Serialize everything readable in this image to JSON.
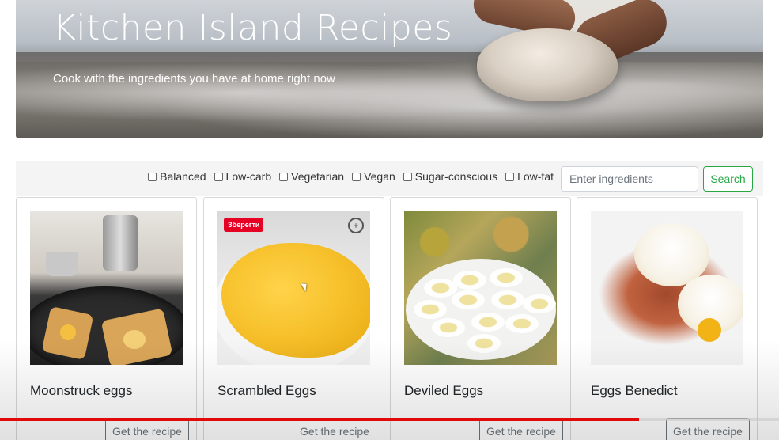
{
  "hero": {
    "title": "Kitchen Island Recipes",
    "subtitle": "Cook with the ingredients you have at home right now"
  },
  "search": {
    "filters": [
      "Balanced",
      "Low-carb",
      "Vegetarian",
      "Vegan",
      "Sugar-conscious",
      "Low-fat"
    ],
    "input_value": "",
    "input_placeholder": "Enter ingredients",
    "button_label": "Search"
  },
  "recipes": [
    {
      "title": "Moonstruck eggs",
      "button_label": "Get the recipe"
    },
    {
      "title": "Scrambled Eggs",
      "button_label": "Get the recipe",
      "save_badge": "Зберегти"
    },
    {
      "title": "Deviled Eggs",
      "button_label": "Get the recipe"
    },
    {
      "title": "Eggs Benedict",
      "button_label": "Get the recipe"
    }
  ],
  "video": {
    "progress_fraction": 0.82,
    "progress_color": "#e10a0a"
  },
  "colors": {
    "accent_green": "#28a745",
    "button_gray": "#6c757d"
  }
}
